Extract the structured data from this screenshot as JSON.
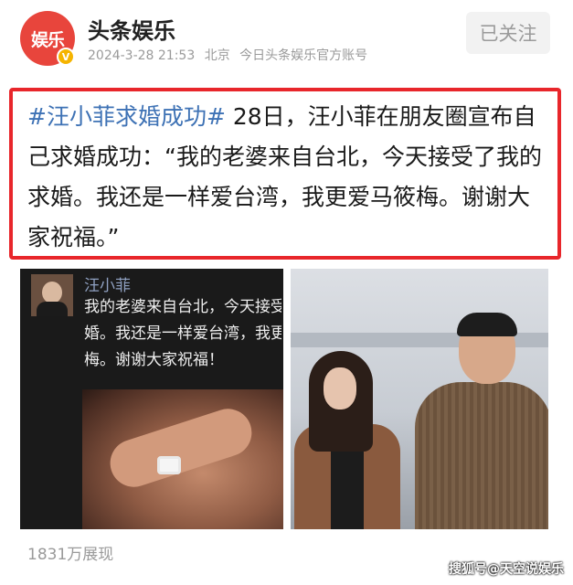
{
  "header": {
    "avatar_text": "娱乐",
    "verified_badge": "V",
    "author_name": "头条娱乐",
    "date": "2024-3-28 21:53",
    "location": "北京",
    "account_desc": "今日头条娱乐官方账号",
    "follow_label": "已关注"
  },
  "post": {
    "hashtag": "#汪小菲求婚成功#",
    "body": " 28日，汪小菲在朋友圈宣布自己求婚成功：“我的老婆来自台北，今天接受了我的求婚。我还是一样爱台湾，我更爱马筱梅。谢谢大家祝福。”"
  },
  "images": {
    "left": {
      "moments_name": "汪小菲",
      "moments_text": "我的老婆来自台北，今天接受\n婚。我还是一样爱台湾，我更\n梅。谢谢大家祝福！"
    }
  },
  "footer": {
    "views": "1831万展现",
    "watermark": "搜狐号@天空说娱乐"
  },
  "colors": {
    "highlight_border": "#e8262b",
    "hashtag": "#3e72b5",
    "avatar_bg": "#e8453c",
    "meta_text": "#9a9a9a"
  }
}
